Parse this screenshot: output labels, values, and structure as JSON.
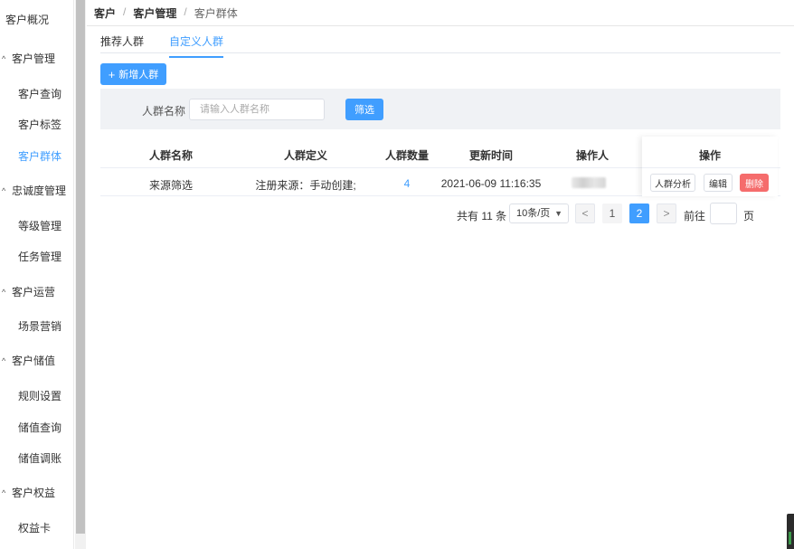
{
  "sidebar": {
    "top": "客户概况",
    "groups": [
      {
        "label": "客户管理",
        "items": [
          "客户查询",
          "客户标签",
          "客户群体"
        ]
      },
      {
        "label": "忠诚度管理",
        "items": [
          "等级管理",
          "任务管理"
        ]
      },
      {
        "label": "客户运营",
        "items": [
          "场景营销"
        ]
      },
      {
        "label": "客户储值",
        "items": [
          "规则设置",
          "储值查询",
          "储值调账"
        ]
      },
      {
        "label": "客户权益",
        "items": [
          "权益卡"
        ]
      }
    ],
    "active_item": "客户群体",
    "chevron": "^"
  },
  "breadcrumb": {
    "level1": "客户",
    "level2": "客户管理",
    "level3": "客户群体",
    "separator": "/"
  },
  "tabs": [
    {
      "label": "推荐人群",
      "active": false
    },
    {
      "label": "自定义人群",
      "active": true
    }
  ],
  "toolbar": {
    "new_label": "新增人群",
    "plus": "+"
  },
  "filter": {
    "label": "人群名称",
    "placeholder": "请输入人群名称",
    "button": "筛选"
  },
  "table": {
    "headers": [
      "人群名称",
      "人群定义",
      "人群数量",
      "更新时间",
      "操作人",
      "操作"
    ],
    "rows": [
      {
        "name": "来源筛选",
        "definition": "注册来源：手动创建;",
        "count": "4",
        "updated": "2021-06-09 11:16:35"
      }
    ],
    "actions": {
      "analyze": "人群分析",
      "edit": "编辑",
      "delete": "删除"
    }
  },
  "pagination": {
    "total": "共有 11 条",
    "page_size": "10条/页",
    "pages": [
      "1",
      "2"
    ],
    "current": "2",
    "prev": "<",
    "next": ">",
    "goto": "前往",
    "page_word": "页"
  },
  "colors": {
    "primary": "#409eff",
    "danger": "#f56c6c"
  }
}
